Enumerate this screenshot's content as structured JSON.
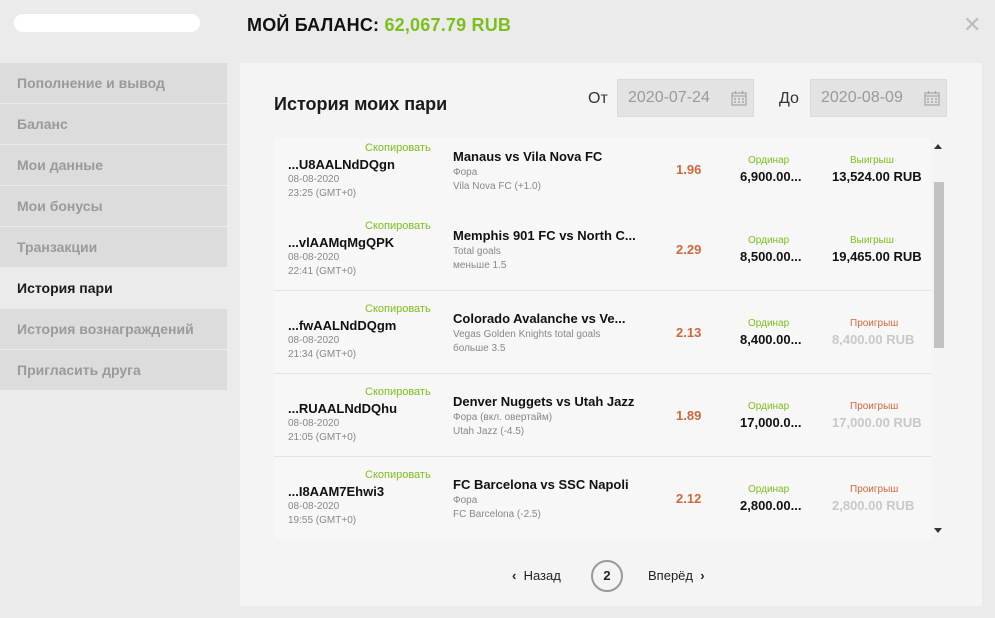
{
  "header": {
    "balance_label": "МОЙ БАЛАНС:",
    "balance_amount": "62,067.79 RUB",
    "close_icon": "close-icon"
  },
  "sidebar": {
    "items": [
      {
        "label": "Пополнение и вывод"
      },
      {
        "label": "Баланс"
      },
      {
        "label": "Мои данные"
      },
      {
        "label": "Мои бонусы"
      },
      {
        "label": "Транзакции"
      },
      {
        "label": "История пари"
      },
      {
        "label": "История вознаграждений"
      },
      {
        "label": "Пригласить друга"
      }
    ],
    "active": "История пари"
  },
  "main": {
    "title": "История моих пари",
    "from_label": "От",
    "from_value": "2020-07-24",
    "to_label": "До",
    "to_value": "2020-08-09",
    "calendar_icon": "calendar-icon"
  },
  "bets": [
    {
      "copy": "Скопировать",
      "id": "...U8AALNdDQgn",
      "date": "08-08-2020",
      "time": "23:25 (GMT+0)",
      "match": "Manaus vs Vila Nova FC",
      "market": "Фора",
      "selection": "Vila Nova FC (+1.0)",
      "odds": "1.96",
      "bet_type": "Ординар",
      "stake": "6,900.00...",
      "result": "Выигрыш",
      "result_amount": "13,524.00 RUB",
      "status": "win"
    },
    {
      "copy": "Скопировать",
      "id": "...vlAAMqMgQPK",
      "date": "08-08-2020",
      "time": "22:41 (GMT+0)",
      "match": "Memphis 901 FC vs North C...",
      "market": "Total goals",
      "selection": "меньше 1.5",
      "odds": "2.29",
      "bet_type": "Ординар",
      "stake": "8,500.00...",
      "result": "Выигрыш",
      "result_amount": "19,465.00 RUB",
      "status": "win"
    },
    {
      "copy": "Скопировать",
      "id": "...fwAALNdDQgm",
      "date": "08-08-2020",
      "time": "21:34 (GMT+0)",
      "match": "Colorado Avalanche vs Ve...",
      "market": "Vegas Golden Knights total goals",
      "selection": "больше 3.5",
      "odds": "2.13",
      "bet_type": "Ординар",
      "stake": "8,400.00...",
      "result": "Проигрыш",
      "result_amount": "8,400.00 RUB",
      "status": "lose"
    },
    {
      "copy": "Скопировать",
      "id": "...RUAALNdDQhu",
      "date": "08-08-2020",
      "time": "21:05 (GMT+0)",
      "match": "Denver Nuggets vs Utah Jazz",
      "market": "Фора (вкл. овертайм)",
      "selection": "Utah Jazz (-4.5)",
      "odds": "1.89",
      "bet_type": "Ординар",
      "stake": "17,000.0...",
      "result": "Проигрыш",
      "result_amount": "17,000.00 RUB",
      "status": "lose"
    },
    {
      "copy": "Скопировать",
      "id": "...I8AAM7Ehwi3",
      "date": "08-08-2020",
      "time": "19:55 (GMT+0)",
      "match": "FC Barcelona vs SSC Napoli",
      "market": "Фора",
      "selection": "FC Barcelona (-2.5)",
      "odds": "2.12",
      "bet_type": "Ординар",
      "stake": "2,800.00...",
      "result": "Проигрыш",
      "result_amount": "2,800.00 RUB",
      "status": "lose"
    }
  ],
  "pagination": {
    "prev_label": "Назад",
    "next_label": "Вперёд",
    "current_page": "2"
  },
  "colors": {
    "accent_green": "#7cbf1d",
    "odds_orange": "#d0683e"
  }
}
